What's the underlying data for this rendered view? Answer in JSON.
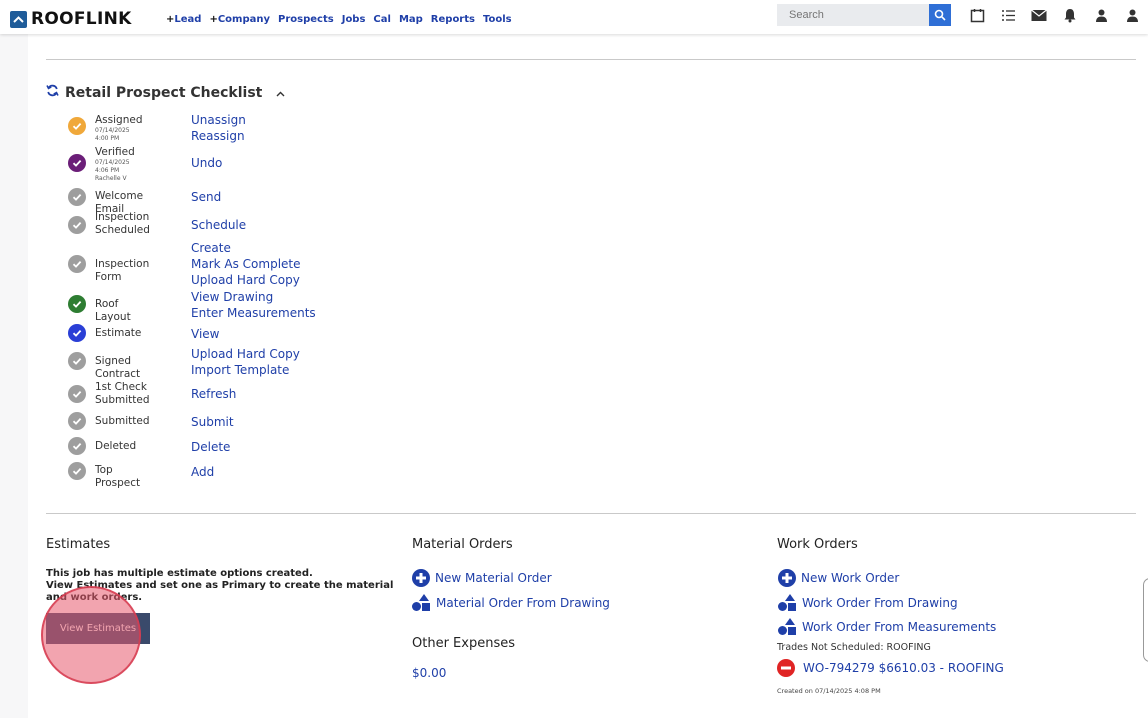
{
  "brand": {
    "logo_text": "ROOFLINK",
    "accent": "#1f5c99"
  },
  "nav": {
    "items": [
      {
        "label": "Lead",
        "plus": "+"
      },
      {
        "label": "Company",
        "plus": "+"
      },
      {
        "label": "Prospects"
      },
      {
        "label": "Jobs"
      },
      {
        "label": "Cal"
      },
      {
        "label": "Map"
      },
      {
        "label": "Reports"
      },
      {
        "label": "Tools"
      }
    ]
  },
  "search": {
    "placeholder": "Search"
  },
  "top_icons": [
    "calendar-icon",
    "list-icon",
    "mail-icon",
    "bell-icon",
    "users-icon",
    "user-icon"
  ],
  "checklist": {
    "title": "Retail Prospect Checklist",
    "items": [
      {
        "label": "Assigned",
        "meta1": "07/14/2025 4:00 PM",
        "meta2": "",
        "status": "orange",
        "actions": [
          "Unassign",
          "Reassign"
        ]
      },
      {
        "label": "Verified",
        "meta1": "07/14/2025 4:06 PM",
        "meta2": "Rachelle V",
        "status": "purple",
        "actions": [
          "Undo"
        ]
      },
      {
        "label": "Welcome Email",
        "meta1": "",
        "meta2": "",
        "status": "gray",
        "actions": [
          "Send"
        ]
      },
      {
        "label": "Inspection Scheduled",
        "meta1": "",
        "meta2": "",
        "status": "gray",
        "actions": [
          "Schedule"
        ]
      },
      {
        "label": "Inspection Form",
        "meta1": "",
        "meta2": "",
        "status": "gray",
        "actions": [
          "Create",
          "Mark As Complete",
          "Upload Hard Copy"
        ]
      },
      {
        "label": "Roof Layout",
        "meta1": "",
        "meta2": "",
        "status": "green",
        "actions": [
          "View Drawing",
          "Enter Measurements"
        ]
      },
      {
        "label": "Estimate",
        "meta1": "",
        "meta2": "",
        "status": "blue",
        "actions": [
          "View"
        ]
      },
      {
        "label": "Signed Contract",
        "meta1": "",
        "meta2": "",
        "status": "gray",
        "actions": [
          "Upload Hard Copy",
          "Import Template"
        ]
      },
      {
        "label": "1st Check Submitted",
        "meta1": "",
        "meta2": "",
        "status": "gray",
        "actions": [
          "Refresh"
        ]
      },
      {
        "label": "Submitted",
        "meta1": "",
        "meta2": "",
        "status": "gray",
        "actions": [
          "Submit"
        ]
      },
      {
        "label": "Deleted",
        "meta1": "",
        "meta2": "",
        "status": "gray",
        "actions": [
          "Delete"
        ]
      },
      {
        "label": "Top Prospect",
        "meta1": "",
        "meta2": "",
        "status": "gray",
        "actions": [
          "Add"
        ]
      }
    ]
  },
  "status_colors": {
    "orange": "#f0a83a",
    "purple": "#6b1e78",
    "gray": "#9e9e9e",
    "green": "#2e7d32",
    "blue": "#2a3fd6"
  },
  "estimates": {
    "title": "Estimates",
    "line1": "This job has multiple estimate options created.",
    "line2": "View Estimates and set one as Primary to create the material and work orders.",
    "button_label": "View Estimates"
  },
  "material_orders": {
    "title": "Material Orders",
    "new_link": "New Material Order",
    "from_drawing_link": "Material Order From Drawing"
  },
  "other_expenses": {
    "title": "Other Expenses",
    "amount": "$0.00"
  },
  "work_orders": {
    "title": "Work Orders",
    "new_link": "New Work Order",
    "from_drawing_link": "Work Order From Drawing",
    "from_measurements_link": "Work Order From Measurements",
    "trades_note": "Trades Not Scheduled: ROOFING",
    "order_link": "WO-794279 $6610.03 - ROOFING",
    "created_note": "Created on 07/14/2025 4:08 PM"
  }
}
